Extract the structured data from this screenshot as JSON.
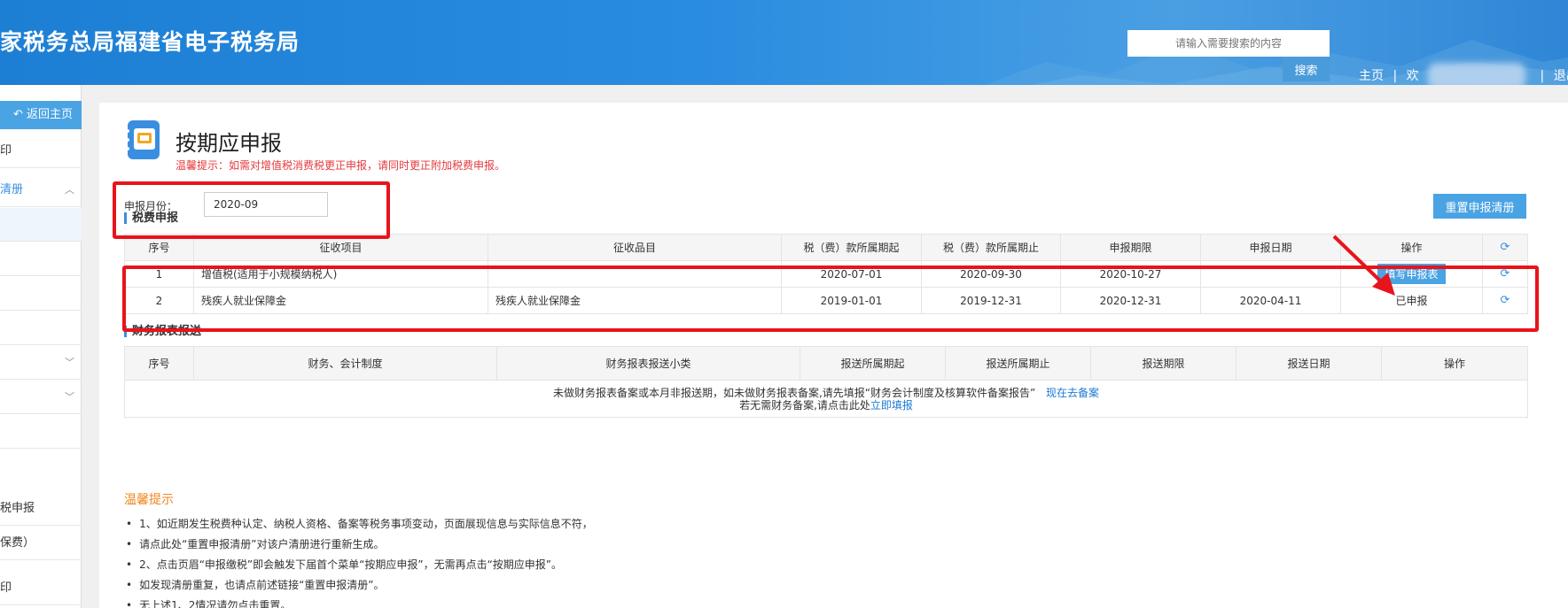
{
  "header": {
    "site_title": "家税务总局福建省电子税务局",
    "search_placeholder": "请输入需要搜索的内容",
    "search_button": "搜索",
    "nav_home": "主页",
    "nav_sep1": "|",
    "nav_welcome": "欢",
    "nav_sep2": "|",
    "nav_logout": "退出"
  },
  "sidebar": {
    "back_home": "返回主页",
    "items": [
      {
        "label": "印"
      },
      {
        "label": "清册"
      },
      {
        "label": ""
      },
      {
        "label": ""
      },
      {
        "label": ""
      },
      {
        "label": ""
      },
      {
        "label": ""
      },
      {
        "label": ""
      },
      {
        "label": ""
      },
      {
        "label": "税申报"
      },
      {
        "label": "保费）"
      },
      {
        "label": "印"
      }
    ]
  },
  "main": {
    "title": "按期应申报",
    "warning": "温馨提示：如需对增值税消费税更正申报，请同时更正附加税费申报。",
    "month_label": "申报月份：",
    "month_value": "2020-09",
    "reset_button": "重置申报清册",
    "tax_section_title": "税费申报",
    "tax_table": {
      "headers": [
        "序号",
        "征收项目",
        "征收品目",
        "税（费）款所属期起",
        "税（费）款所属期止",
        "申报期限",
        "申报日期",
        "操作"
      ],
      "rows": [
        {
          "no": "1",
          "item": "增值税(适用于小规模纳税人)",
          "sub_item": "",
          "start": "2020-07-01",
          "end": "2020-09-30",
          "deadline": "2020-10-27",
          "date": "",
          "action": "填写申报表"
        },
        {
          "no": "2",
          "item": "残疾人就业保障金",
          "sub_item": "残疾人就业保障金",
          "start": "2019-01-01",
          "end": "2019-12-31",
          "deadline": "2020-12-31",
          "date": "2020-04-11",
          "action": "已申报"
        }
      ]
    },
    "finance_section_title": "财务报表报送",
    "finance_table": {
      "headers": [
        "序号",
        "财务、会计制度",
        "财务报表报送小类",
        "报送所属期起",
        "报送所属期止",
        "报送期限",
        "报送日期",
        "操作"
      ],
      "note_line1": "未做财务报表备案或本月非报送期，如未做财务报表备案,请先填报“财务会计制度及核算软件备案报告”",
      "note_link1": "现在去备案",
      "note_line2": "若无需财务备案,请点击此处",
      "note_link2": "立即填报"
    },
    "tips_title": "温馨提示",
    "tips": [
      "1、如近期发生税费种认定、纳税人资格、备案等税务事项变动，页面展现信息与实际信息不符，",
      "请点此处“重置申报清册”对该户清册进行重新生成。",
      "2、点击页眉“申报缴税”即会触发下届首个菜单“按期应申报”，无需再点击“按期应申报”。",
      "如发现清册重复，也请点前述链接“重置申报清册”。",
      "无上述1、2情况请勿点击重置。"
    ]
  }
}
